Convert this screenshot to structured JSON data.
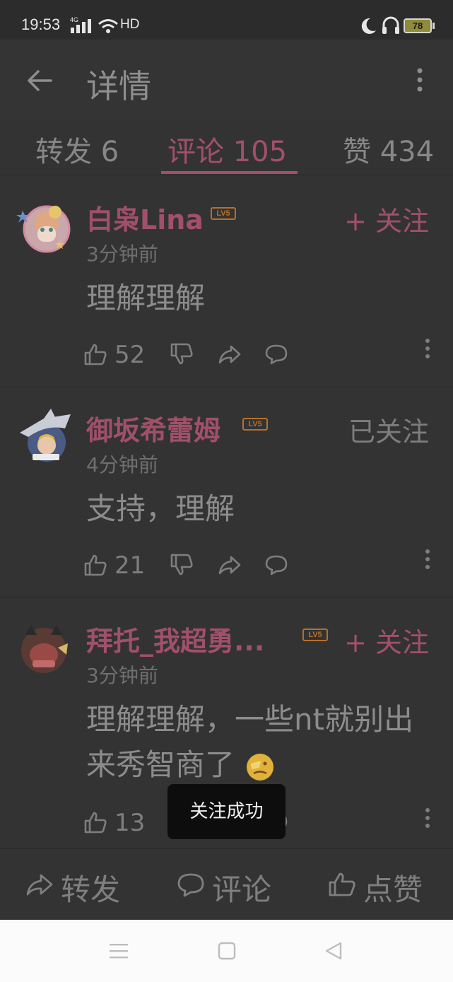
{
  "status_bar": {
    "time": "19:53",
    "network": "4G",
    "hd": "HD",
    "battery": "78"
  },
  "header": {
    "title": "详情"
  },
  "tabs": [
    {
      "label": "转发 6"
    },
    {
      "label": "评论 105"
    },
    {
      "label": "赞 434"
    }
  ],
  "comments": [
    {
      "username": "白枭Lina",
      "level": "LV5",
      "follow": "+ 关注",
      "time": "3分钟前",
      "text": "理解理解",
      "likes": "52"
    },
    {
      "username": "御坂希蕾姆",
      "level": "LV5",
      "follow": "已关注",
      "time": "4分钟前",
      "text": "支持，理解",
      "likes": "21"
    },
    {
      "username": "拜托_我超勇...",
      "level": "LV5",
      "follow": "+ 关注",
      "time": "3分钟前",
      "text": "理解理解，一些nt就别出来秀智商了",
      "likes": "13"
    }
  ],
  "toast": "关注成功",
  "bottom_bar": {
    "repost": "转发",
    "comment": "评论",
    "like": "点赞"
  },
  "colors": {
    "accent": "#a1506a",
    "background": "#333333",
    "badge": "#b5702b"
  }
}
